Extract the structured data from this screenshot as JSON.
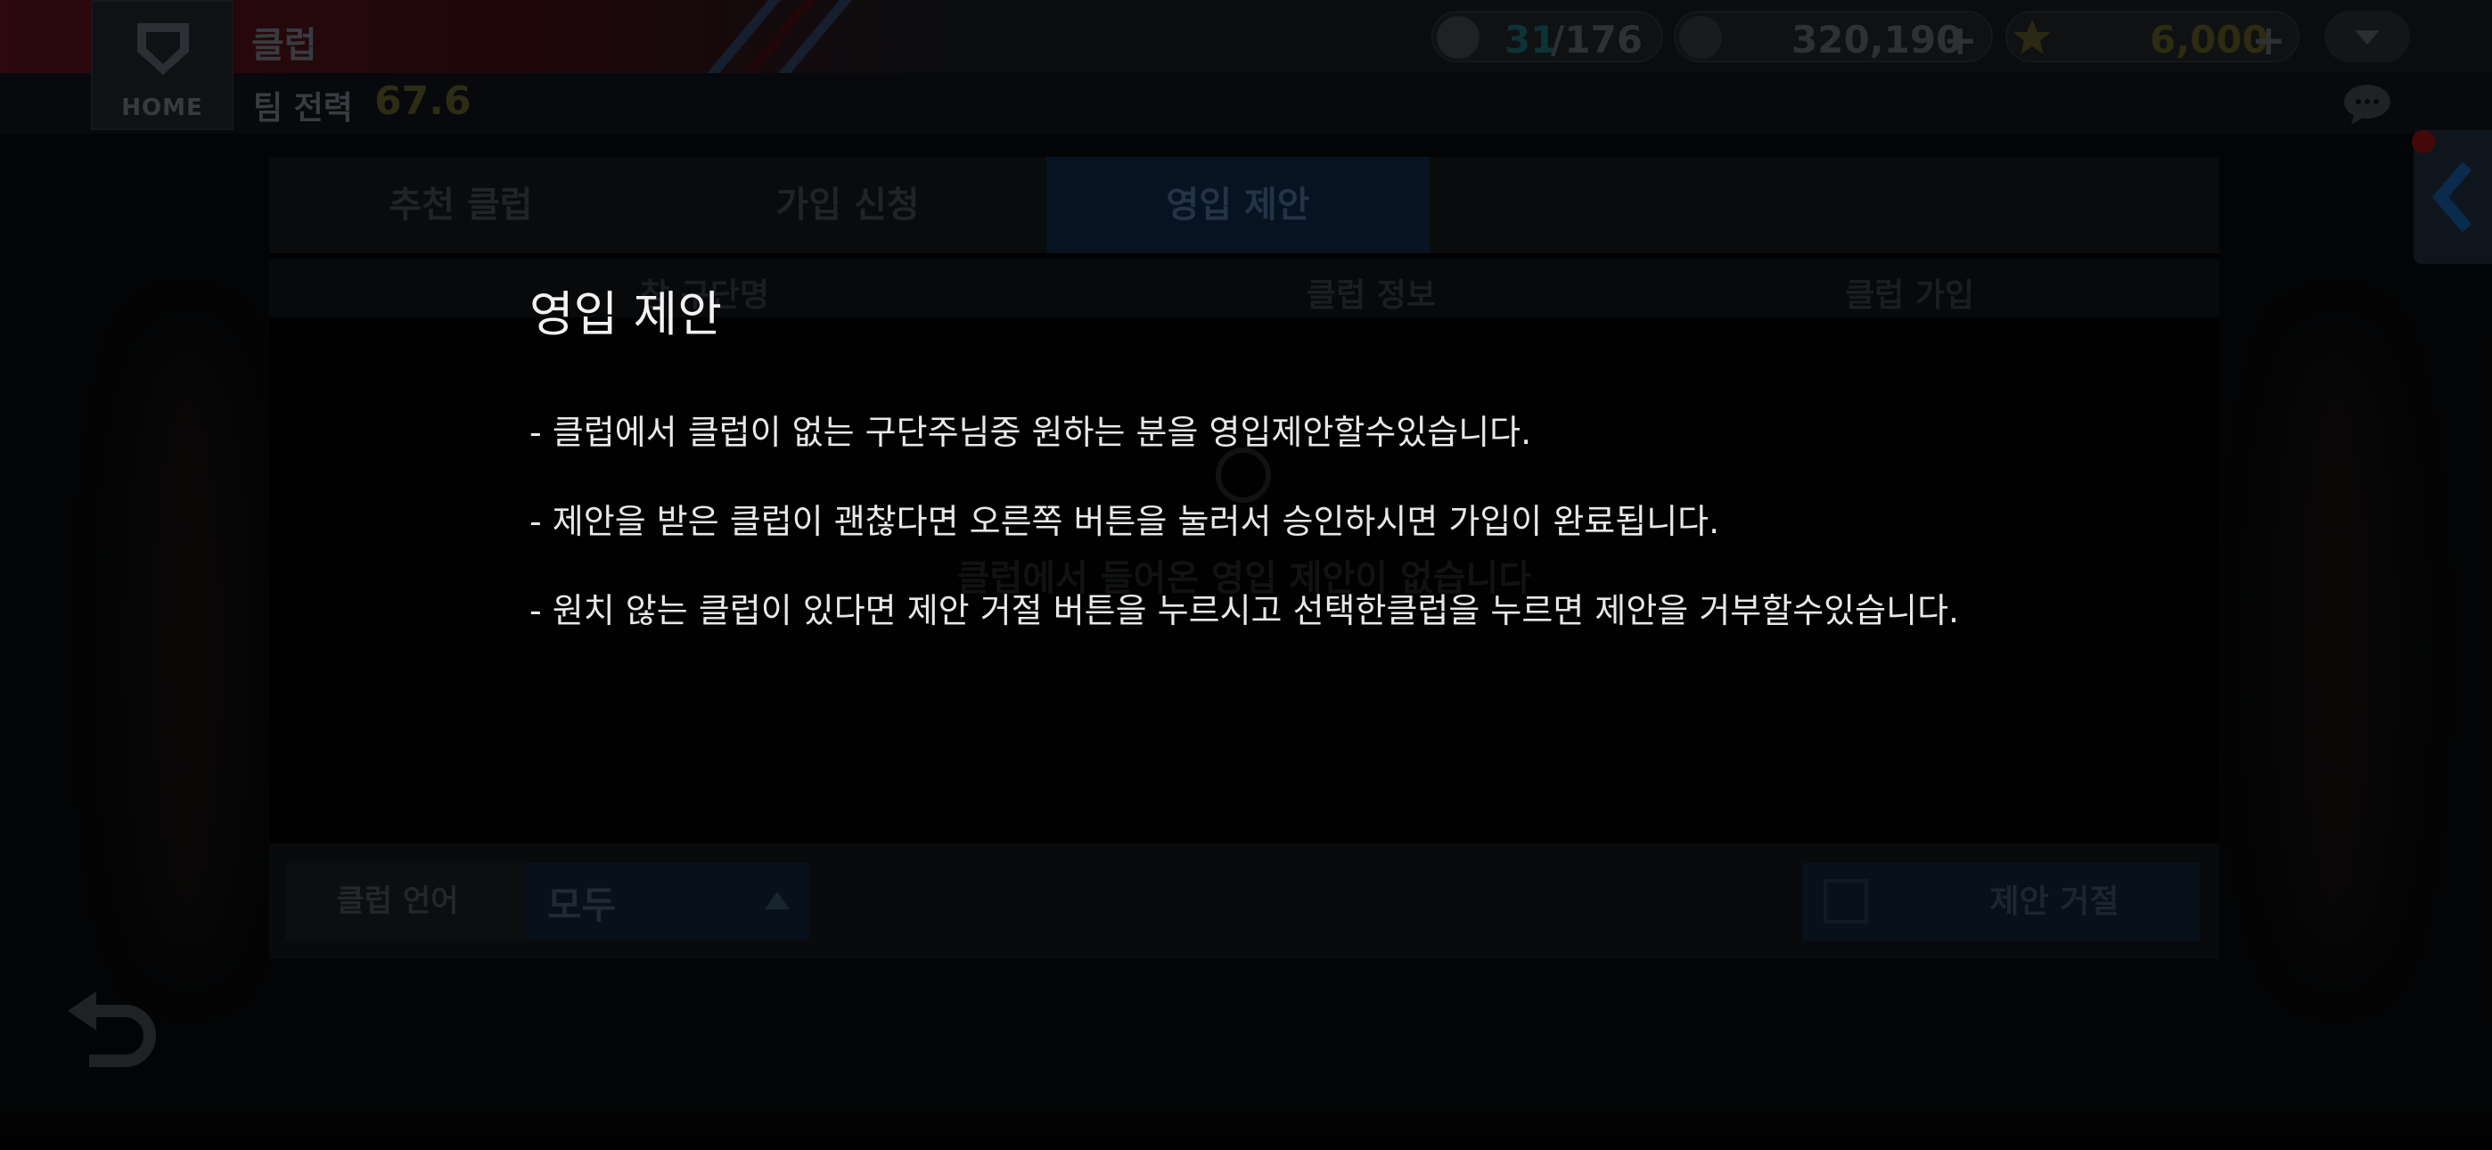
{
  "header": {
    "home_label": "HOME",
    "title": "클럽",
    "team_power_label": "팀 전력",
    "team_power_value": "67.6",
    "stamina": {
      "current": "31",
      "max": "/176",
      "icon": "baseball-icon",
      "color": "#12444a"
    },
    "points": {
      "value": "320,190",
      "plus": "+",
      "icon": "p-coin-icon"
    },
    "stars": {
      "value": "6,000",
      "plus": "+",
      "icon": "star-icon"
    },
    "dropdown_icon": "chevron-down-icon",
    "chat_icon": "chat-bubble-icon",
    "side_tab_icon": "chevron-left-icon"
  },
  "tabs": [
    {
      "label": "추천 클럽"
    },
    {
      "label": "가입 신청"
    },
    {
      "label": "영입 제안"
    }
  ],
  "columns": [
    "창 구단명",
    "클럽 정보",
    "클럽 가입"
  ],
  "empty_state": {
    "icon": "exclamation-icon",
    "text": "클럽에서 들어온 영입 제안이 없습니다"
  },
  "filter": {
    "label": "클럽 언어",
    "value": "모두"
  },
  "reject_button": {
    "label": "제안 거절"
  },
  "help": {
    "title": "영입 제안",
    "lines": [
      "- 클럽에서 클럽이 없는 구단주님중 원하는 분을 영입제안할수있습니다.",
      "- 제안을 받은 클럽이 괜찮다면 오른쪽 버튼을 눌러서 승인하시면 가입이 완료됩니다.",
      "- 원치 않는 클럽이 있다면 제안 거절 버튼을 누르시고 선택한클럽을 누르면 제안을 거부할수있습니다."
    ]
  },
  "colors": {
    "active_tab": "#0a1a2c",
    "accent_blue": "#1f66a8",
    "team_red": "#3a0c10"
  }
}
